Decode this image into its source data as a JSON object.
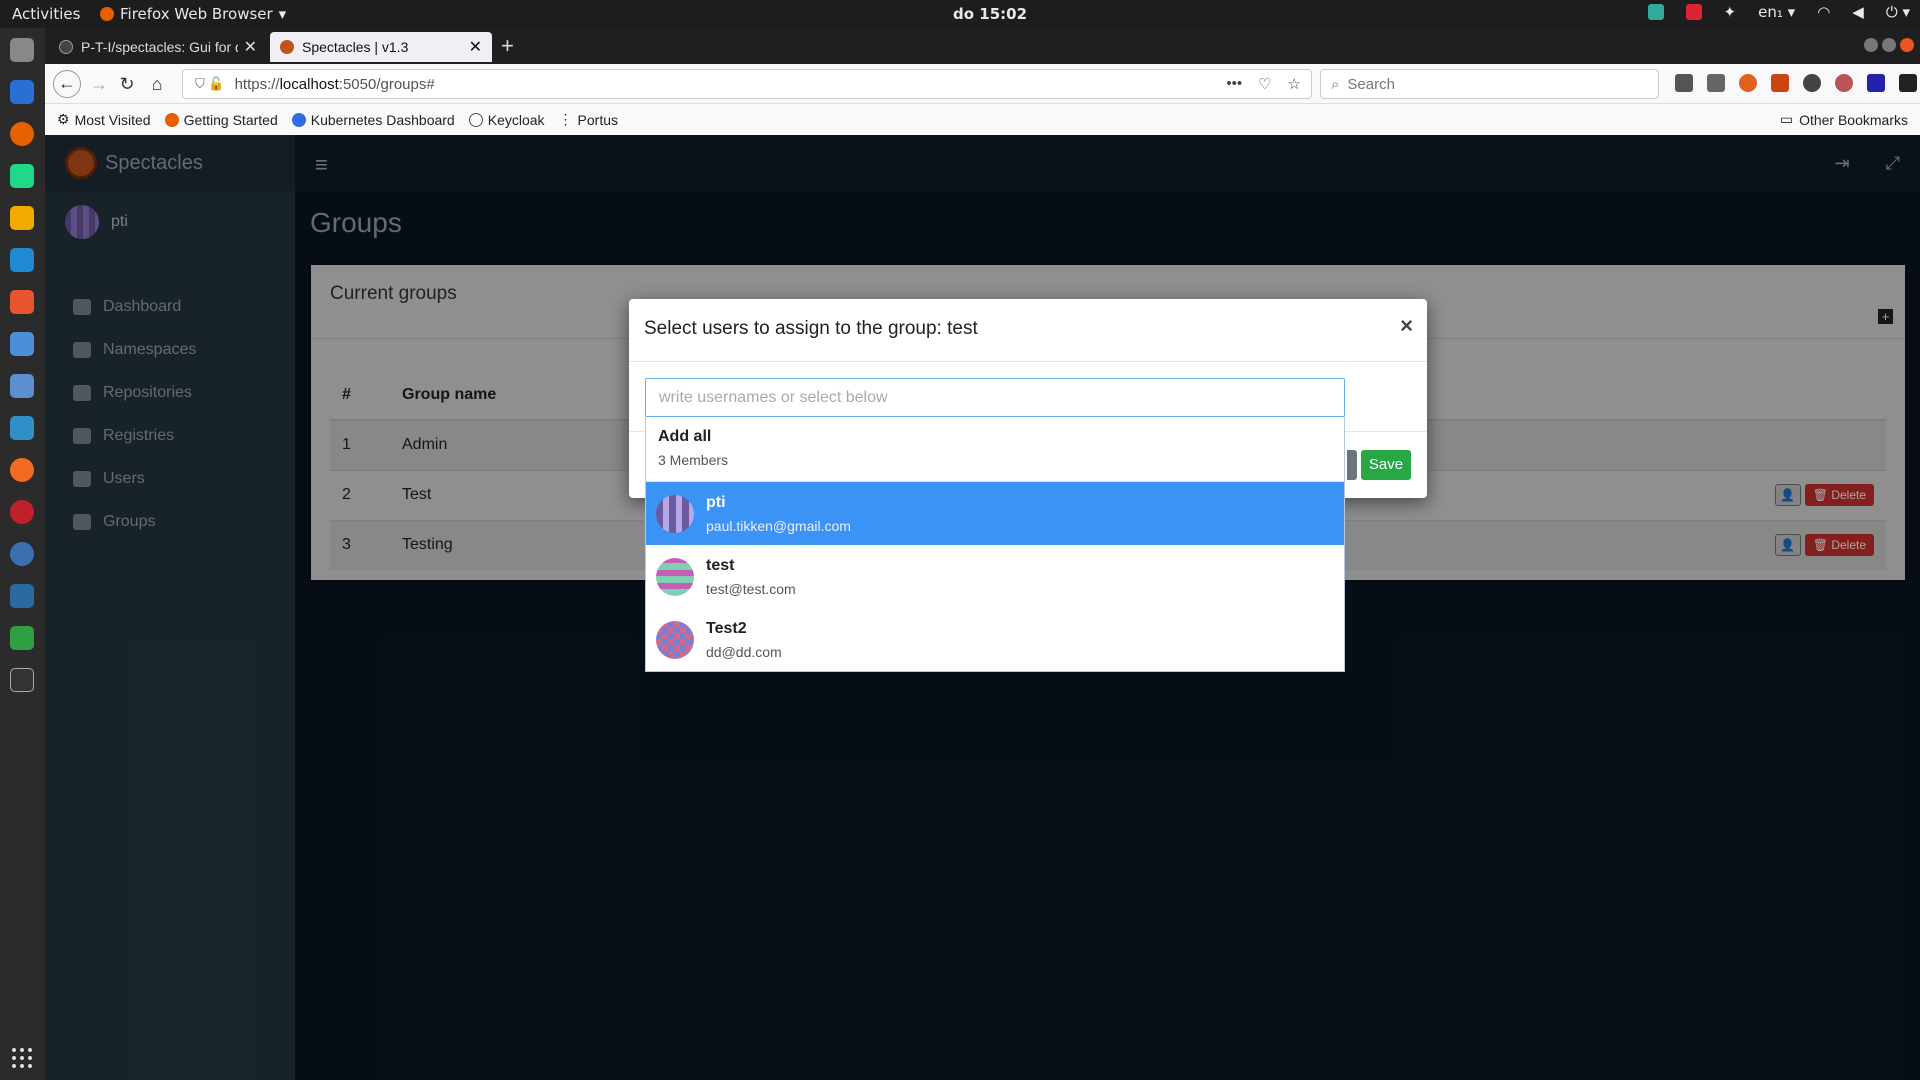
{
  "os": {
    "activities": "Activities",
    "app_name": "Firefox Web Browser",
    "clock": "do 15:02",
    "lang": "en₁"
  },
  "browser": {
    "tabs": [
      {
        "title": "P-T-I/spectacles: Gui for d",
        "active": false
      },
      {
        "title": "Spectacles | v1.3",
        "active": true
      }
    ],
    "url_prefix": "https://",
    "url_host": "localhost",
    "url_rest": ":5050/groups#",
    "search_placeholder": "Search",
    "bookmarks": [
      "Most Visited",
      "Getting Started",
      "Kubernetes Dashboard",
      "Keycloak",
      "Portus"
    ],
    "other_bookmarks": "Other Bookmarks"
  },
  "app": {
    "brand": "Spectacles",
    "user": "pti",
    "menu": [
      "Dashboard",
      "Namespaces",
      "Repositories",
      "Registries",
      "Users",
      "Groups"
    ],
    "page_title": "Groups",
    "card_title": "Current groups",
    "table": {
      "headers": [
        "#",
        "Group name"
      ],
      "rows": [
        {
          "num": "1",
          "name": "Admin",
          "delete": ""
        },
        {
          "num": "2",
          "name": "Test",
          "delete": "Delete"
        },
        {
          "num": "3",
          "name": "Testing",
          "delete": "Delete"
        }
      ]
    }
  },
  "modal": {
    "title": "Select users to assign to the group: test",
    "close": "×",
    "input_placeholder": "write usernames or select below",
    "add_all": "Add all",
    "member_count": "3 Members",
    "options": [
      {
        "name": "pti",
        "email": "paul.tikken@gmail.com",
        "selected": true
      },
      {
        "name": "test",
        "email": "test@test.com",
        "selected": false
      },
      {
        "name": "Test2",
        "email": "dd@dd.com",
        "selected": false
      }
    ],
    "save": "Save"
  }
}
